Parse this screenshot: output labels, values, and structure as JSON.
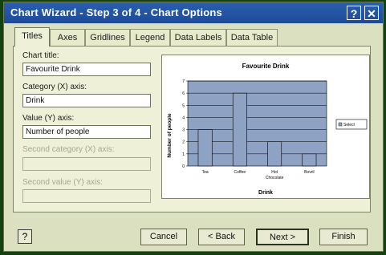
{
  "window": {
    "title": "Chart Wizard - Step 3 of 4 - Chart Options",
    "help_glyph": "?",
    "close_glyph": "✕"
  },
  "tabs": [
    "Titles",
    "Axes",
    "Gridlines",
    "Legend",
    "Data Labels",
    "Data Table"
  ],
  "fields": {
    "chart_title": {
      "label": "Chart title:",
      "value": "Favourite Drink"
    },
    "category_axis": {
      "label": "Category (X) axis:",
      "value": "Drink"
    },
    "value_axis": {
      "label": "Value (Y) axis:",
      "value": "Number of people"
    },
    "second_category_axis": {
      "label": "Second category (X) axis:",
      "value": ""
    },
    "second_value_axis": {
      "label": "Second value (Y) axis:",
      "value": ""
    }
  },
  "buttons": {
    "help": "?",
    "cancel": "Cancel",
    "back": "< Back",
    "next": "Next >",
    "finish": "Finish"
  },
  "colors": {
    "title_bar": "#1d4a98",
    "bar_fill": "#8ea2c4",
    "plot_bg": "#8ea2c4"
  },
  "chart_data": {
    "type": "bar",
    "title": "Favourite Drink",
    "xlabel": "Drink",
    "ylabel": "Number of people",
    "categories": [
      "Tea",
      "Coffee",
      "Hot Chocolate",
      "Bovril"
    ],
    "series": [
      {
        "name": "Select",
        "values": [
          3,
          6,
          2,
          1
        ]
      }
    ],
    "ylim": [
      0,
      7
    ],
    "yticks": [
      "0",
      "1",
      "2",
      "3",
      "4",
      "5",
      "6",
      "7"
    ],
    "grid": true,
    "legend": "right"
  }
}
